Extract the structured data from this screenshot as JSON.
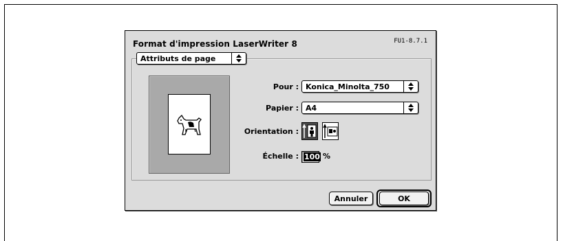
{
  "dialog": {
    "title": "Format d'impression LaserWriter 8",
    "version": "FU1-8.7.1",
    "section_popup": {
      "value": "Attributs de page",
      "icon": "up-down-arrows-icon"
    },
    "preview": {
      "icon": "dogcow-icon"
    },
    "fields": {
      "pour": {
        "label": "Pour :",
        "value": "Konica_Minolta_750"
      },
      "papier": {
        "label": "Papier :",
        "value": "A4"
      },
      "orientation": {
        "label": "Orientation :",
        "options": [
          {
            "name": "portrait",
            "icon": "portrait-orientation-icon",
            "selected": true
          },
          {
            "name": "landscape",
            "icon": "landscape-orientation-icon",
            "selected": false
          }
        ]
      },
      "echelle": {
        "label": "Échelle :",
        "value": "100",
        "unit": "%"
      }
    },
    "buttons": {
      "cancel": "Annuler",
      "ok": "OK"
    }
  }
}
